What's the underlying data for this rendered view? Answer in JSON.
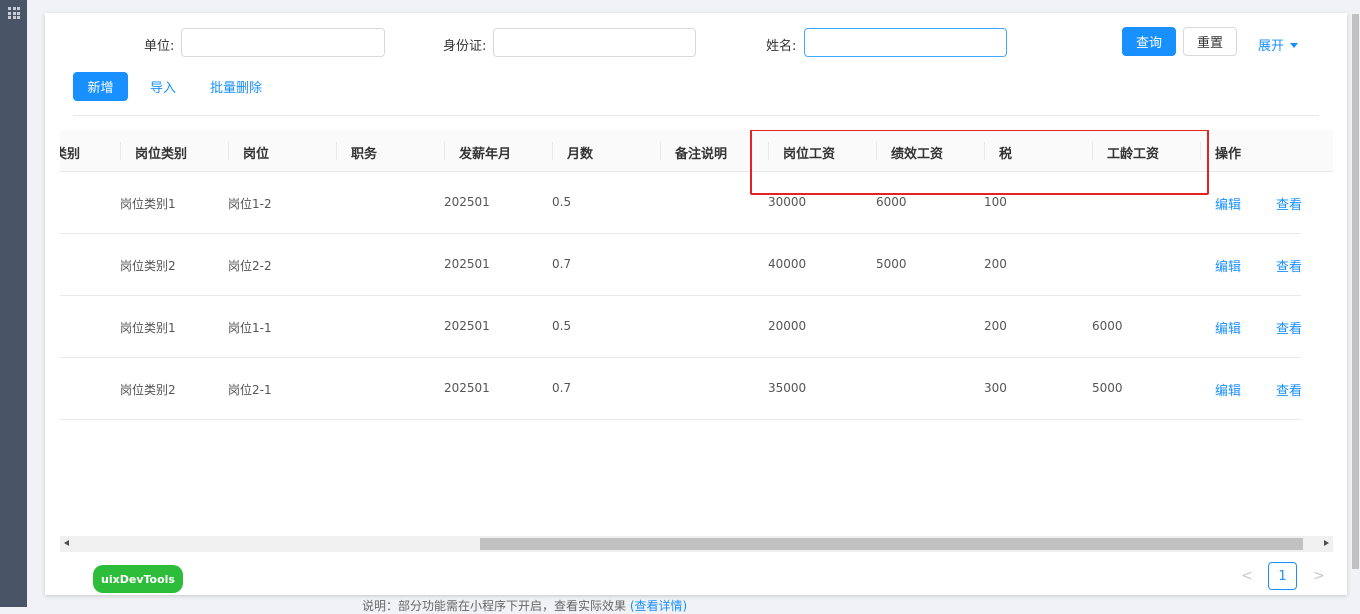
{
  "search": {
    "unit_label": "单位:",
    "unit_value": "",
    "id_label": "身份证:",
    "id_value": "",
    "name_label": "姓名:",
    "name_value": "",
    "query_button": "查询",
    "reset_button": "重置",
    "expand_link": "展开"
  },
  "toolbar": {
    "add_button": "新增",
    "import_button": "导入",
    "batch_delete_button": "批量删除"
  },
  "table": {
    "columns": [
      "类别",
      "岗位类别",
      "岗位",
      "职务",
      "发薪年月",
      "月数",
      "备注说明",
      "岗位工资",
      "绩效工资",
      "税",
      "工龄工资",
      "操作"
    ],
    "rows": [
      {
        "post_category": "岗位类别1",
        "post": "岗位1-2",
        "duty": "",
        "pay_month": "202501",
        "months": "0.5",
        "remark": "",
        "post_salary": "30000",
        "perf_salary": "6000",
        "tax": "100",
        "seniority_salary": "",
        "edit": "编辑",
        "view": "查看"
      },
      {
        "post_category": "岗位类别2",
        "post": "岗位2-2",
        "duty": "",
        "pay_month": "202501",
        "months": "0.7",
        "remark": "",
        "post_salary": "40000",
        "perf_salary": "5000",
        "tax": "200",
        "seniority_salary": "",
        "edit": "编辑",
        "view": "查看"
      },
      {
        "post_category": "岗位类别1",
        "post": "岗位1-1",
        "duty": "",
        "pay_month": "202501",
        "months": "0.5",
        "remark": "",
        "post_salary": "20000",
        "perf_salary": "",
        "tax": "200",
        "seniority_salary": "6000",
        "edit": "编辑",
        "view": "查看"
      },
      {
        "post_category": "岗位类别2",
        "post": "岗位2-1",
        "duty": "",
        "pay_month": "202501",
        "months": "0.7",
        "remark": "",
        "post_salary": "35000",
        "perf_salary": "",
        "tax": "300",
        "seniority_salary": "5000",
        "edit": "编辑",
        "view": "查看"
      }
    ]
  },
  "bottom": {
    "dev_badge": "uixDevTools",
    "pager_prev": "<",
    "pager_current": "1",
    "pager_next": ">",
    "note_text": "说明：部分功能需在小程序下开启，查看实际效果",
    "note_link": "(查看详情)"
  },
  "colors": {
    "primary": "#1890ff",
    "highlight": "#e02424",
    "dev_badge": "#2dbd3a",
    "left_rail": "#4a5467"
  }
}
